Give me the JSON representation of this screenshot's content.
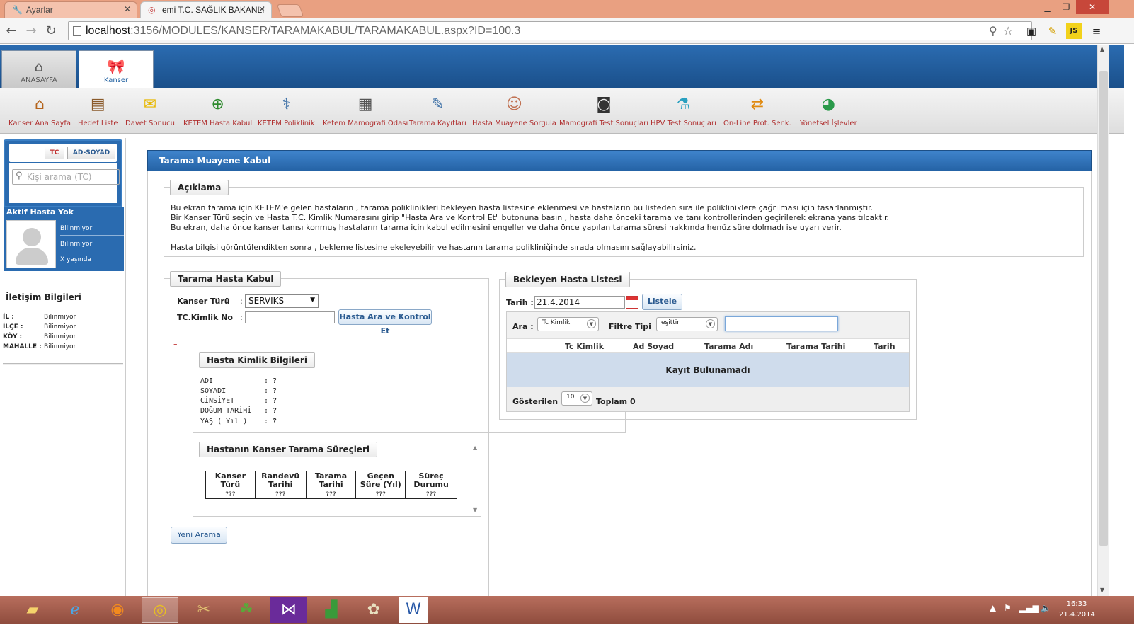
{
  "browser": {
    "tabs": [
      {
        "title": "Ayarlar",
        "icon": "wrench-icon"
      },
      {
        "title": "emi T.C. SAĞLIK BAKANLI",
        "icon": "cancer-ribbon-icon"
      }
    ],
    "url_host": "localhost",
    "url_path": ":3156/MODULES/KANSER/TARAMAKABUL/TARAMAKABUL.aspx?ID=100.3"
  },
  "app_tabs": {
    "home": "ANASAYFA",
    "cancer": "Kanser"
  },
  "toolbar": [
    {
      "label": "Kanser Ana Sayfa",
      "icon": "home-icon"
    },
    {
      "label": "Hedef Liste",
      "icon": "list-icon"
    },
    {
      "label": "Davet Sonucu",
      "icon": "envelope-icon"
    },
    {
      "label": "KETEM Hasta Kabul",
      "icon": "add-patient-icon"
    },
    {
      "label": "KETEM Poliklinik",
      "icon": "stethoscope-icon"
    },
    {
      "label": "Ketem Mamografi Odası",
      "icon": "mammography-room-icon"
    },
    {
      "label": "Tarama Kayıtları",
      "icon": "records-icon"
    },
    {
      "label": "Hasta Muayene Sorgula",
      "icon": "doctor-icon"
    },
    {
      "label": "Mamografi Test Sonuçları",
      "icon": "xray-icon"
    },
    {
      "label": "HPV Test Sonuçları",
      "icon": "flask-icon"
    },
    {
      "label": "On-Line Prot. Senk.",
      "icon": "sync-arrows-icon"
    },
    {
      "label": "Yönetsel İşlevler",
      "icon": "pie-chart-icon"
    }
  ],
  "left": {
    "search_tab_tc": "TC",
    "search_tab_name": "AD-SOYAD",
    "search_placeholder": "Kişi arama (TC)",
    "patient_title": "Aktif Hasta Yok",
    "patient_rows": [
      "Bilinmiyor",
      "Bilinmiyor",
      "X yaşında"
    ],
    "contact_title": "İletişim Bilgileri",
    "contact": [
      {
        "key": "İL :",
        "value": "Bilinmiyor"
      },
      {
        "key": "İLÇE :",
        "value": "Bilinmiyor"
      },
      {
        "key": "KÖY :",
        "value": "Bilinmiyor"
      },
      {
        "key": "MAHALLE :",
        "value": "Bilinmiyor"
      }
    ]
  },
  "main": {
    "header": "Tarama Muayene Kabul",
    "desc_legend": "Açıklama",
    "desc_lines": [
      "Bu ekran tarama için KETEM'e gelen hastaların , tarama poliklinikleri bekleyen hasta listesine eklenmesi ve hastaların bu listeden sıra ile polikliniklere çağrılması için tasarlanmıştır.",
      "Bir Kanser Türü seçin ve Hasta T.C. Kimlik Numarasını girip \"Hasta Ara ve Kontrol Et\" butonuna basın , hasta daha önceki tarama ve tanı kontrollerinden geçirilerek ekrana yansıtılcaktır.",
      "Bu ekran, daha önce kanser tanısı konmuş hastaların tarama için kabul edilmesini engeller ve daha önce yapılan tarama süresi hakkında henüz süre dolmadı ise uyarı verir.",
      "",
      "Hasta bilgisi görüntülendikten sonra , bekleme listesine ekeleyebilir ve hastanın tarama polikliniğinde sırada olmasını sağlayabilirsiniz."
    ],
    "intake_legend": "Tarama Hasta Kabul",
    "cancer_type_label": "Kanser Türü",
    "cancer_type_value": "SERVIKS",
    "tc_label": "TC.Kimlik No",
    "search_button": "Hasta Ara ve Kontrol Et",
    "dash": "–",
    "identity_legend": "Hasta Kimlik Bilgileri",
    "identity": [
      {
        "key": "ADI",
        "value": "?"
      },
      {
        "key": "SOYADI",
        "value": "?"
      },
      {
        "key": "CİNSİYET",
        "value": "?"
      },
      {
        "key": "DOĞUM TARİHİ",
        "value": "?"
      },
      {
        "key": "YAŞ ( Yıl )",
        "value": "?"
      }
    ],
    "process_legend": "Hastanın Kanser Tarama Süreçleri",
    "process_headers": [
      "Kanser Türü",
      "Randevü Tarihi",
      "Tarama Tarihi",
      "Geçen Süre (Yıl)",
      "Süreç Durumu"
    ],
    "process_row": [
      "???",
      "???",
      "???",
      "???",
      "???"
    ],
    "new_search_button": "Yeni Arama",
    "waiting_legend": "Bekleyen Hasta Listesi",
    "date_label": "Tarih :",
    "date_value": "21.4.2014",
    "list_button": "Listele",
    "search_label": "Ara :",
    "search_field": "Tc Kimlik",
    "filter_label": "Filtre Tipi",
    "filter_value": "eşittir",
    "grid_headers": [
      "Tc Kimlik",
      "Ad Soyad",
      "Tarama Adı",
      "Tarama Tarihi",
      "Tarih"
    ],
    "empty_text": "Kayıt Bulunamadı",
    "shown_label": "Gösterilen",
    "page_size": "10",
    "total_text": "Toplam 0"
  },
  "taskbar": {
    "time": "16:33",
    "date": "21.4.2014"
  }
}
